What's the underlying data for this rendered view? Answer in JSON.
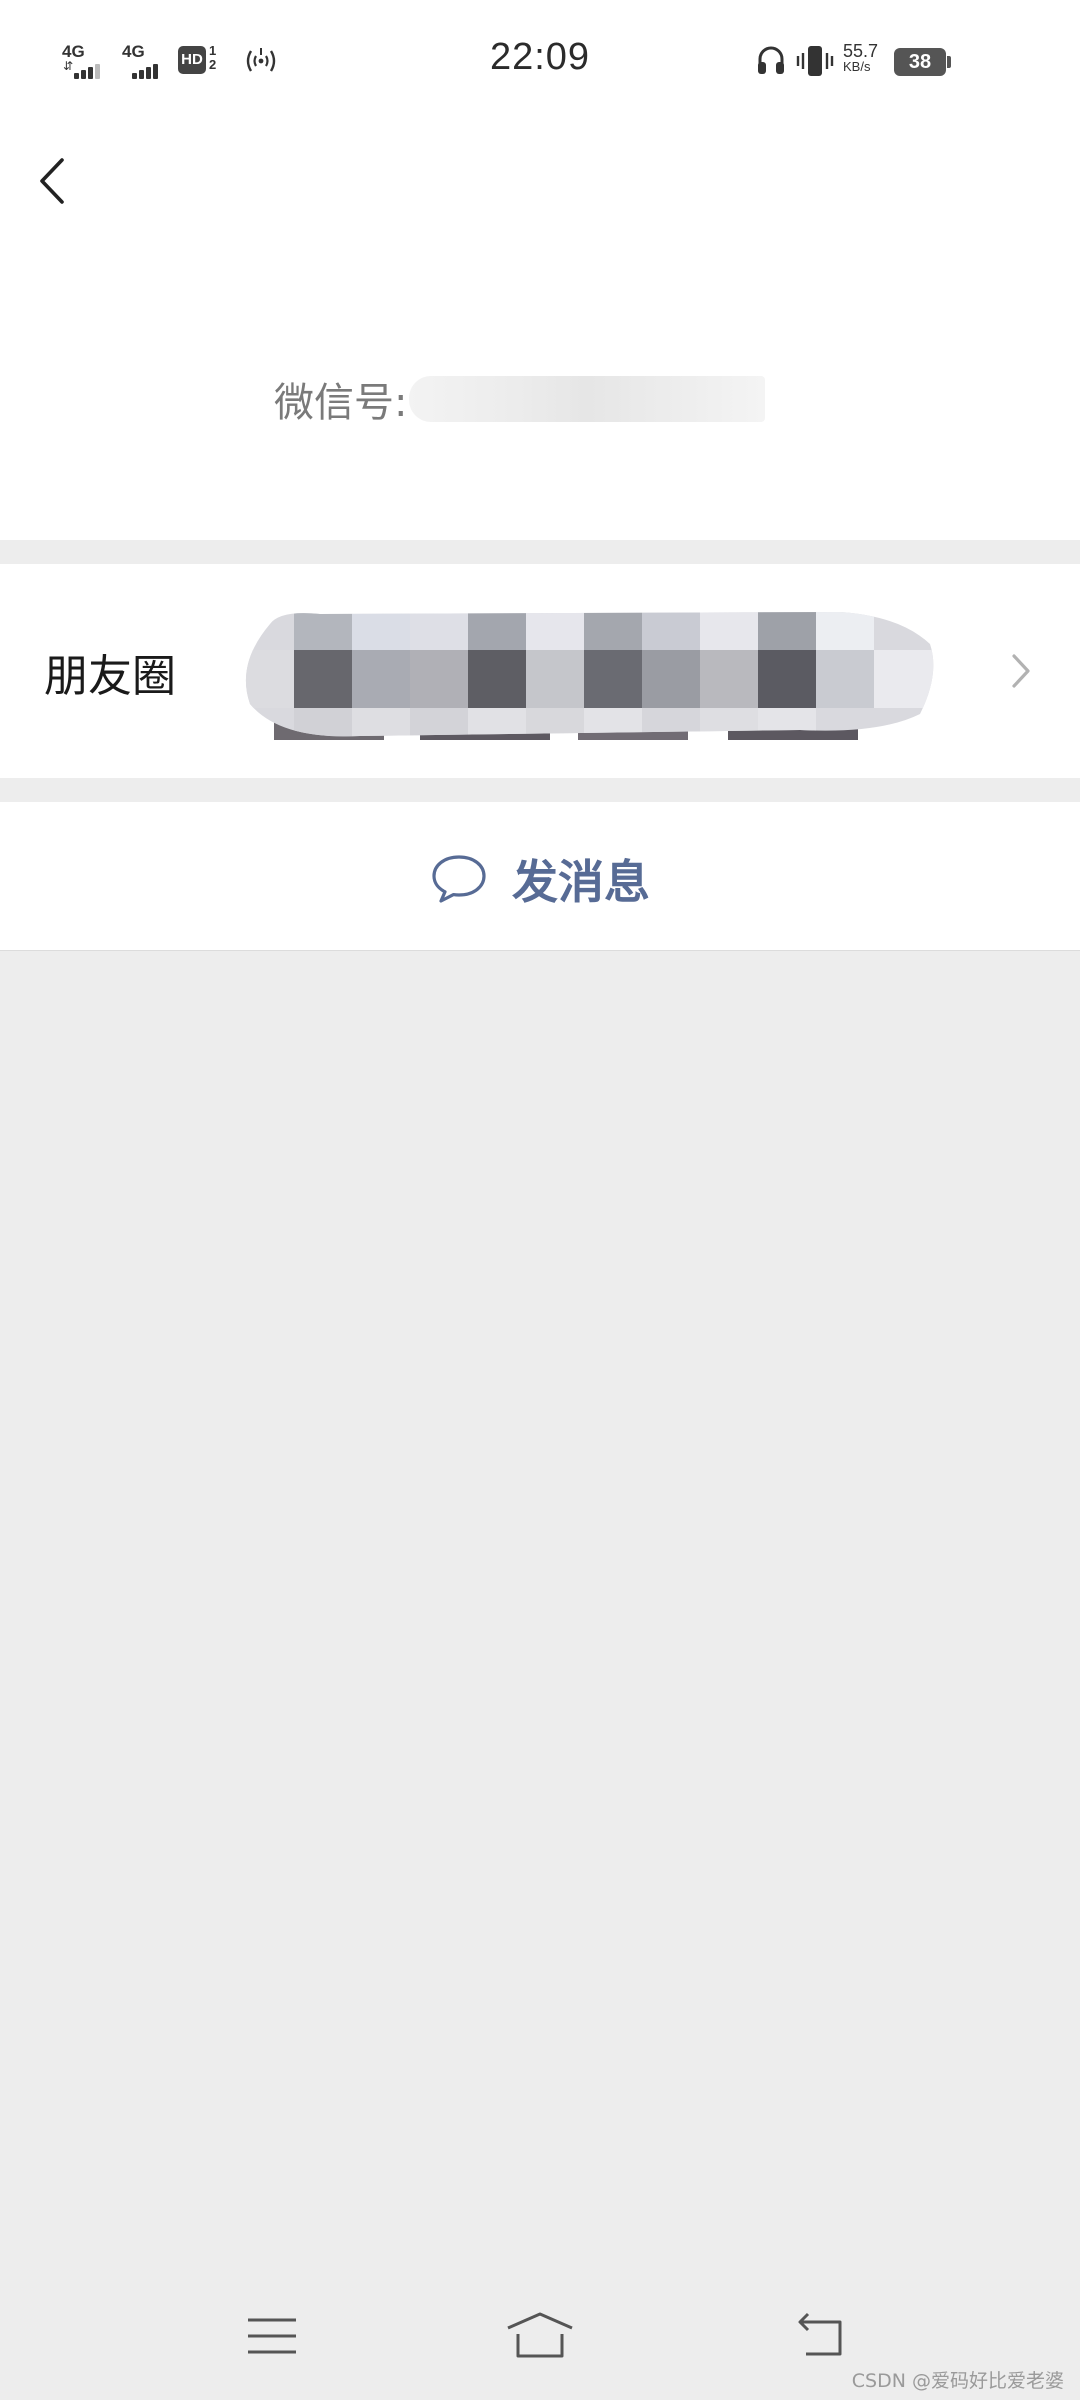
{
  "status_bar": {
    "sim1_network": "4G",
    "sim2_network": "4G",
    "hd_label": "HD",
    "hd_superscript": "1\n2",
    "time": "22:09",
    "net_speed_value": "55.7",
    "net_speed_unit": "KB/s",
    "battery_level": "38",
    "icons": [
      "signal-sim1-icon",
      "signal-sim2-icon",
      "hd-volte-icon",
      "hotspot-icon",
      "headphone-icon",
      "vibrate-icon",
      "battery-icon"
    ]
  },
  "header": {
    "back_icon": "chevron-left-icon"
  },
  "profile": {
    "wechat_id_label": "微信号:"
  },
  "moments": {
    "label": "朋友圈",
    "chevron_icon": "chevron-right-icon"
  },
  "actions": {
    "send_message_label": "发消息",
    "send_message_icon": "chat-bubble-icon",
    "accent_color": "#576b95"
  },
  "nav_bar": {
    "icons": [
      "menu-icon",
      "home-icon",
      "back-icon"
    ]
  },
  "watermark": "CSDN @爱码好比爱老婆"
}
